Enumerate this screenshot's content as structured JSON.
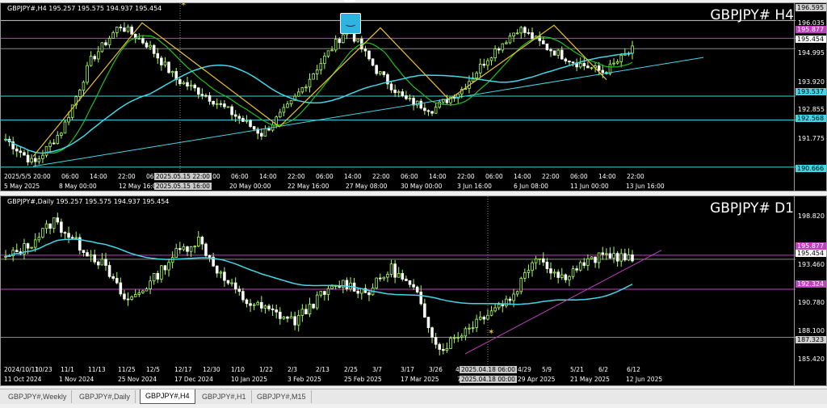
{
  "h4": {
    "ohlc_text": "GBPJPY#,H4  195.257 195.575 194.937 195.454",
    "symbol_label": "GBPJPY#  H4",
    "price_axis": {
      "labels": [
        "196.595",
        "196.035",
        "195.454",
        "194.995",
        "193.920",
        "193.537",
        "192.855",
        "192.568",
        "191.775",
        "190.666"
      ],
      "range": [
        190.5,
        196.9
      ]
    },
    "boxes": {
      "resistance": "195.877",
      "current": "195.454",
      "support1": "193.537",
      "support2": "192.568",
      "bottom": "190.666",
      "top": "196.595"
    },
    "time_labels": [
      "2025/5/5 20:00",
      "06:00",
      "14:00",
      "22:00",
      "06:00",
      "14:00",
      "22:00",
      "06:00",
      "14:00",
      "22:00",
      "06:00",
      "14:00",
      "22:00",
      "06:00",
      "14:00",
      "22:00",
      "06:00",
      "14:00",
      "22:00",
      "06:00",
      "14:00",
      "22:00"
    ],
    "date_labels": [
      "5 May 2025",
      "8 May 00:00",
      "12 May 16:00",
      "20 May 00:00",
      "22 May 16:00",
      "27 May 08:00",
      "30 May 00:00",
      "3 Jun 16:00",
      "6 Jun 08:00",
      "11 Jun 00:00",
      "13 Jun 16:00"
    ],
    "crosshair_tag_top": "2025.05.15 22:00",
    "crosshair_tag_bottom": "2025.05.15 16:00"
  },
  "d1": {
    "ohlc_text": "GBPJPY#,Daily  195.257 195.575 194.937 195.454",
    "symbol_label": "GBPJPY#  D1",
    "price_axis": {
      "labels": [
        "198.820",
        "196.140",
        "195.454",
        "193.460",
        "192.324",
        "190.780",
        "188.100",
        "187.323",
        "185.420"
      ],
      "range": [
        184.5,
        201.0
      ]
    },
    "boxes": {
      "resistance": "195.877",
      "current": "195.454",
      "support": "192.324",
      "bottom": "187.323"
    },
    "time_labels": [
      "2024/10/11",
      "10/23",
      "11/1",
      "11/13",
      "11/25",
      "12/5",
      "12/17",
      "12/30",
      "1/10",
      "1/22",
      "2/3",
      "2/13",
      "2/25",
      "3/7",
      "3/17",
      "3/26",
      "4/7",
      "4/29",
      "5/9",
      "5/21",
      "6/2",
      "6/12"
    ],
    "date_labels": [
      "11 Oct 2024",
      "1 Nov 2024",
      "25 Nov 2024",
      "17 Dec 2024",
      "10 Jan 2025",
      "3 Feb 2025",
      "25 Feb 2025",
      "17 Mar 2025",
      "7 Apr 2025",
      "29 Apr 2025",
      "21 May 2025",
      "12 Jun 2025"
    ],
    "crosshair_tag_top": "2025.04.18 06:00",
    "crosshair_tag_bottom": "2025.04.18 00:00"
  },
  "tabs": [
    "GBPJPY#,Weekly",
    "GBPJPY#,Daily",
    "GBPJPY#,H4",
    "GBPJPY#,H1",
    "GBPJPY#,M15"
  ],
  "active_tab": "GBPJPY#,H4",
  "colors": {
    "background": "#000000",
    "bull": "#a8ff60",
    "zigzag": "#e8c02a",
    "ma_fast": "#20c020",
    "ma_slow": "#40d8e8",
    "resistance": "#c040c0",
    "support": "#40d8e8",
    "trendline": "#40d8e8"
  }
}
